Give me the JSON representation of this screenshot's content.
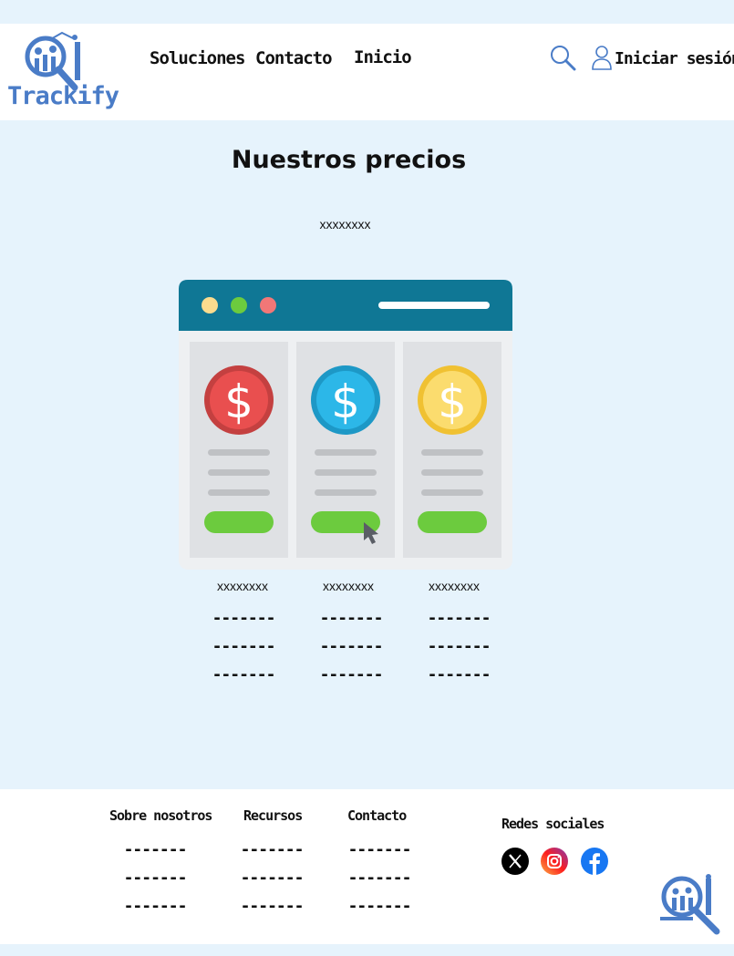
{
  "brand": {
    "name": "Trackify",
    "color": "#4a7cc7"
  },
  "nav": {
    "items": [
      "Soluciones",
      "Contacto",
      "Inicio"
    ],
    "login": "Iniciar sesión"
  },
  "main": {
    "title": "Nuestros precios",
    "subtitle": "xxxxxxxx",
    "plans": [
      {
        "name": "xxxxxxxx",
        "coin_color": "#e94f4f",
        "lines": [
          "-------",
          "-------",
          "-------"
        ]
      },
      {
        "name": "xxxxxxxx",
        "coin_color": "#2cb7e8",
        "lines": [
          "-------",
          "-------",
          "-------"
        ]
      },
      {
        "name": "xxxxxxxx",
        "coin_color": "#fbd748",
        "lines": [
          "-------",
          "-------",
          "-------"
        ]
      }
    ]
  },
  "footer": {
    "columns": [
      {
        "title": "Sobre nosotros",
        "lines": [
          "-------",
          "-------",
          "-------"
        ]
      },
      {
        "title": "Recursos",
        "lines": [
          "-------",
          "-------",
          "-------"
        ]
      },
      {
        "title": "Contacto",
        "lines": [
          "-------",
          "-------",
          "-------"
        ]
      }
    ],
    "social_title": "Redes sociales",
    "social_icons": [
      "x-icon",
      "instagram-icon",
      "facebook-icon"
    ]
  },
  "colors": {
    "page_bg": "#e6f3fc",
    "browser_bar": "#0f7795",
    "button_green": "#6ccb3e"
  }
}
